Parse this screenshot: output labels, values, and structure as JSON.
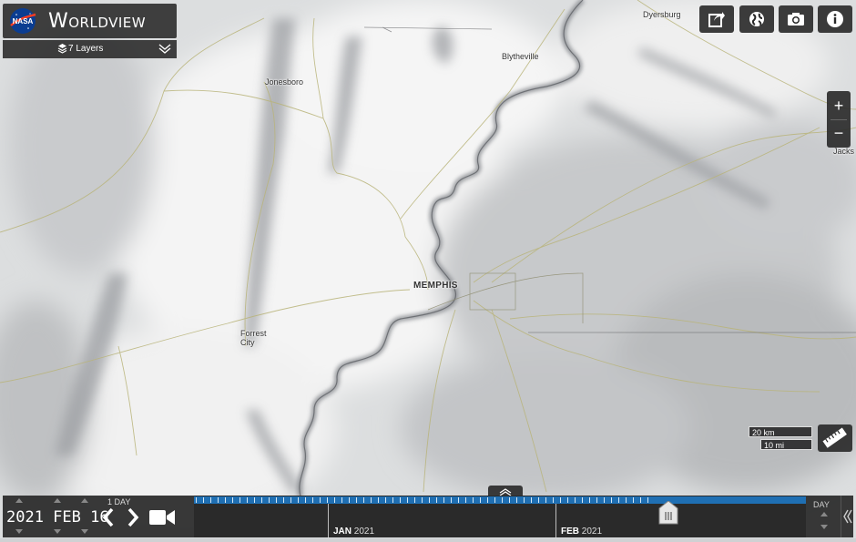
{
  "app": {
    "brand_badge": "NASA",
    "title": "Worldview"
  },
  "layers": {
    "label": "7 Layers"
  },
  "toolbar": {
    "share_icon": "share-icon",
    "projection_icon": "globe-icon",
    "snapshot_icon": "camera-icon",
    "info_icon": "info-icon"
  },
  "zoom": {
    "in_label": "+",
    "out_label": "−"
  },
  "map_labels": {
    "dyersburg": "Dyersburg",
    "blytheville": "Blytheville",
    "jonesboro": "Jonesboro",
    "memphis": "MEMPHIS",
    "forrest_city_line1": "Forrest",
    "forrest_city_line2": "City",
    "jackson": "Jacks"
  },
  "scale": {
    "km": "20 km",
    "mi": "10 mi"
  },
  "timeline": {
    "date": "2021 FEB 16",
    "interval": "1 DAY",
    "zoom_level": "DAY",
    "months": [
      {
        "month": "JAN",
        "year": "2021"
      },
      {
        "month": "FEB",
        "year": "2021"
      }
    ]
  },
  "colors": {
    "panel": "#282828",
    "timeline_bar": "#1f6fb3",
    "snow": "#eeeeee",
    "river": "#8a8d92"
  }
}
